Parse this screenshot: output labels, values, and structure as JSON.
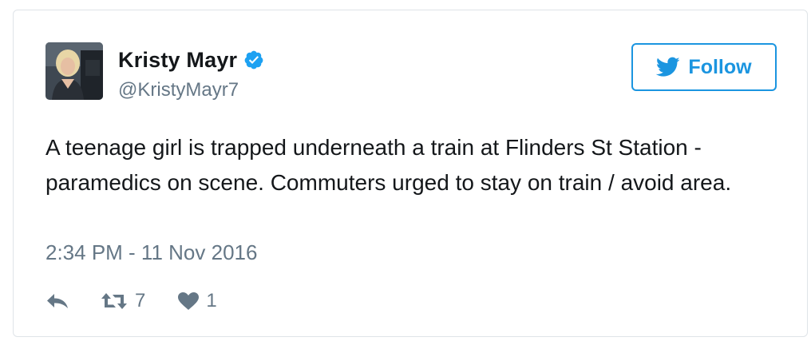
{
  "tweet": {
    "author": {
      "display_name": "Kristy Mayr",
      "handle": "@KristyMayr7",
      "verified": true
    },
    "follow_button": {
      "label": "Follow",
      "icon": "twitter-bird-icon"
    },
    "text": "A teenage girl is trapped underneath a train at Flinders St Station - paramedics on scene. Commuters urged to stay on train / avoid area.",
    "timestamp": "2:34 PM - 11 Nov 2016",
    "actions": {
      "reply": {
        "icon": "reply-icon"
      },
      "retweet": {
        "icon": "retweet-icon",
        "count": "7"
      },
      "like": {
        "icon": "heart-icon",
        "count": "1"
      }
    }
  },
  "colors": {
    "brand_blue": "#1b95e0",
    "verified_blue": "#1da1f2",
    "text_primary": "#14171a",
    "text_secondary": "#657786",
    "border": "#dfe4e8"
  }
}
